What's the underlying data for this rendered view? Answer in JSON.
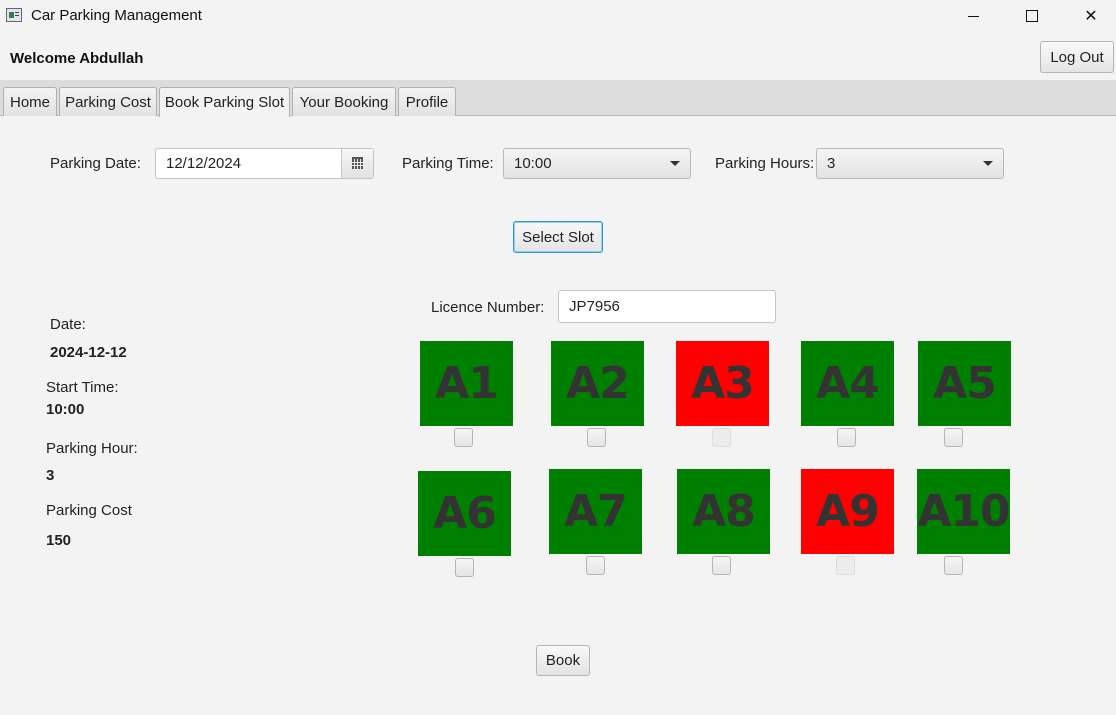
{
  "window": {
    "title": "Car Parking Management"
  },
  "header": {
    "welcome": "Welcome Abdullah",
    "logout_label": "Log Out"
  },
  "tabs": [
    {
      "label": "Home"
    },
    {
      "label": "Parking Cost"
    },
    {
      "label": "Book Parking Slot"
    },
    {
      "label": "Your Booking"
    },
    {
      "label": "Profile"
    }
  ],
  "active_tab": "Book Parking Slot",
  "form": {
    "date_label": "Parking Date:",
    "date_value": "12/12/2024",
    "time_label": "Parking Time:",
    "time_value": "10:00",
    "hours_label": "Parking Hours:",
    "hours_value": "3",
    "select_slot_label": "Select Slot",
    "licence_label": "Licence Number:",
    "licence_value": "JP7956",
    "book_label": "Book"
  },
  "summary": {
    "date_label": "Date:",
    "date_value": "2024-12-12",
    "start_label": "Start Time:",
    "start_value": "10:00",
    "hour_label": "Parking Hour:",
    "hour_value": "3",
    "cost_label": "Parking Cost",
    "cost_value": "150"
  },
  "colors": {
    "available": "#008000",
    "booked": "#ff0000"
  },
  "slots": [
    {
      "label": "A1",
      "status": "available"
    },
    {
      "label": "A2",
      "status": "available"
    },
    {
      "label": "A3",
      "status": "booked"
    },
    {
      "label": "A4",
      "status": "available"
    },
    {
      "label": "A5",
      "status": "available"
    },
    {
      "label": "A6",
      "status": "available"
    },
    {
      "label": "A7",
      "status": "available"
    },
    {
      "label": "A8",
      "status": "available"
    },
    {
      "label": "A9",
      "status": "booked"
    },
    {
      "label": "A10",
      "status": "available"
    }
  ]
}
